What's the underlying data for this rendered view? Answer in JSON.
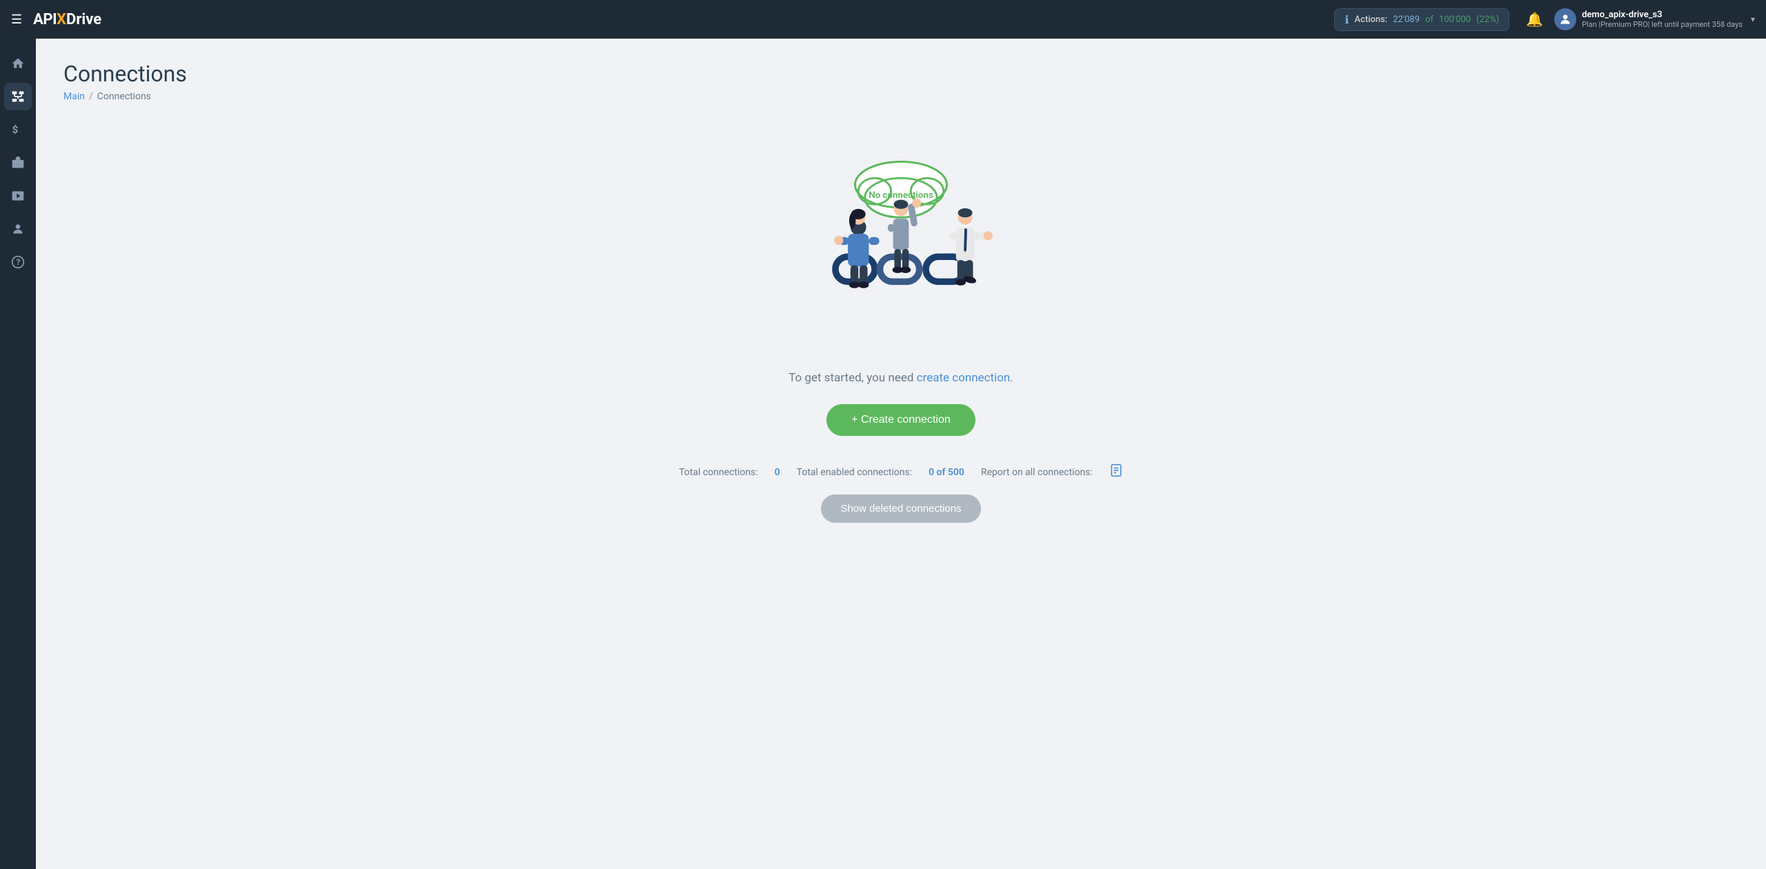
{
  "header": {
    "menu_icon": "☰",
    "logo": {
      "api": "API",
      "x": "X",
      "drive": "Drive"
    },
    "actions": {
      "label": "Actions:",
      "used": "22'089",
      "of_text": "of",
      "total": "100'000",
      "percent": "(22%)"
    },
    "bell_icon": "🔔",
    "user": {
      "name": "demo_apix-drive_s3",
      "plan": "Plan |Premium PRO| left until payment",
      "days": "358 days",
      "avatar_icon": "👤",
      "chevron": "▾"
    }
  },
  "sidebar": {
    "items": [
      {
        "icon": "⌂",
        "name": "home",
        "active": false
      },
      {
        "icon": "⊞",
        "name": "connections",
        "active": true
      },
      {
        "icon": "$",
        "name": "billing",
        "active": false
      },
      {
        "icon": "🧳",
        "name": "services",
        "active": false
      },
      {
        "icon": "▶",
        "name": "videos",
        "active": false
      },
      {
        "icon": "👤",
        "name": "profile",
        "active": false
      },
      {
        "icon": "?",
        "name": "help",
        "active": false
      }
    ]
  },
  "page": {
    "title": "Connections",
    "breadcrumb": {
      "main": "Main",
      "separator": "/",
      "current": "Connections"
    }
  },
  "empty_state": {
    "no_connections_label": "No connections",
    "description_prefix": "To get started, you need",
    "description_link": "create connection.",
    "create_button": "+ Create connection",
    "stats": {
      "total_label": "Total connections:",
      "total_value": "0",
      "enabled_label": "Total enabled connections:",
      "enabled_value": "0 of 500",
      "report_label": "Report on all connections:"
    },
    "show_deleted_button": "Show deleted connections"
  }
}
